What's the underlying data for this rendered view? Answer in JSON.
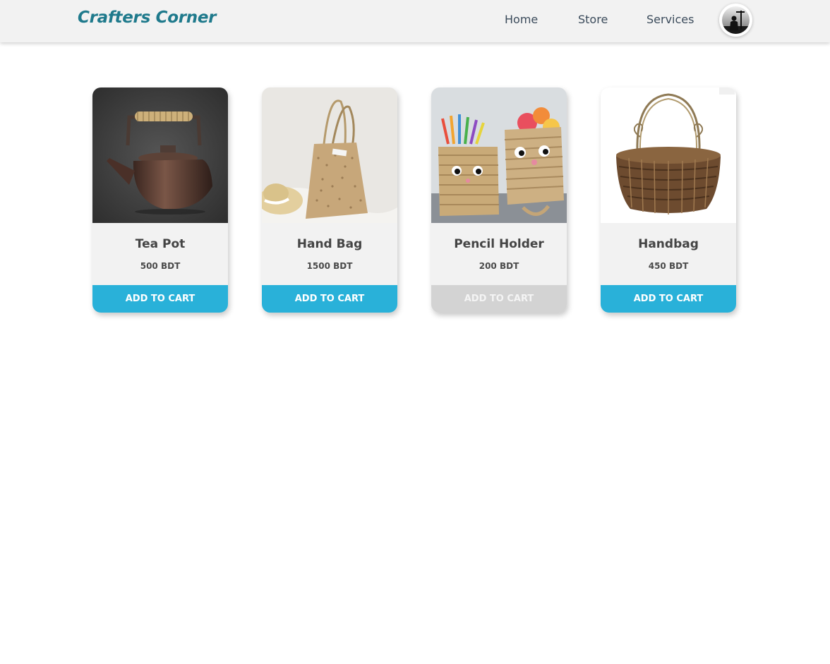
{
  "brand": {
    "name": "Crafters Corner",
    "color": "#1f7a8c"
  },
  "nav": {
    "links": [
      {
        "label": "Home"
      },
      {
        "label": "Store"
      },
      {
        "label": "Services"
      }
    ],
    "avatar_icon": "user-avatar-icon"
  },
  "products": [
    {
      "name": "Tea Pot",
      "price": "500 BDT",
      "button": "ADD TO CART",
      "button_state": "active",
      "image_icon": "teapot-image"
    },
    {
      "name": "Hand Bag",
      "price": "1500 BDT",
      "button": "ADD TO CART",
      "button_state": "active",
      "image_icon": "handbag-image"
    },
    {
      "name": "Pencil Holder",
      "price": "200 BDT",
      "button": "ADD TO CART",
      "button_state": "disabled",
      "image_icon": "pencil-holder-image"
    },
    {
      "name": "Handbag",
      "price": "450 BDT",
      "button": "ADD TO CART",
      "button_state": "active",
      "image_icon": "basket-image"
    }
  ],
  "colors": {
    "accent": "#29b1d9",
    "disabled": "#d3d3d3",
    "card_bg": "#f2f2f2",
    "header_bg": "#f2f2f2"
  }
}
